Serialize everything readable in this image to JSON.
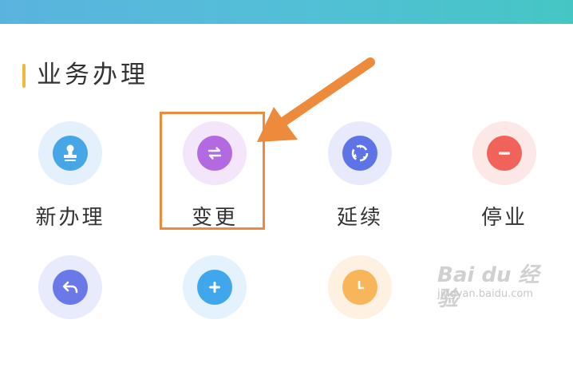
{
  "section": {
    "title": "业务办理"
  },
  "tiles": [
    {
      "label": "新办理",
      "icon": "stamp-icon",
      "color": "#46a6e6"
    },
    {
      "label": "变更",
      "icon": "swap-arrows-icon",
      "color": "#b36ae0"
    },
    {
      "label": "延续",
      "icon": "cycle-arrows-icon",
      "color": "#5e74e6"
    },
    {
      "label": "停业",
      "icon": "minus-circle-icon",
      "color": "#f1635a"
    },
    {
      "label": "",
      "icon": "undo-icon",
      "color": "#6b78e8"
    },
    {
      "label": "",
      "icon": "plus-circle-icon",
      "color": "#41a7ec"
    },
    {
      "label": "",
      "icon": "clock-icon",
      "color": "#f8b55a"
    }
  ],
  "annotation": {
    "highlighted_item": "变更",
    "color": "#ee8a3c"
  },
  "watermark": {
    "brand": "Bai du 经验",
    "sub": "jingyan.baidu.com"
  },
  "colors": {
    "header_gradient": [
      "#5ab3de",
      "#45c6c4"
    ],
    "section_marker": "#f1b93a"
  }
}
